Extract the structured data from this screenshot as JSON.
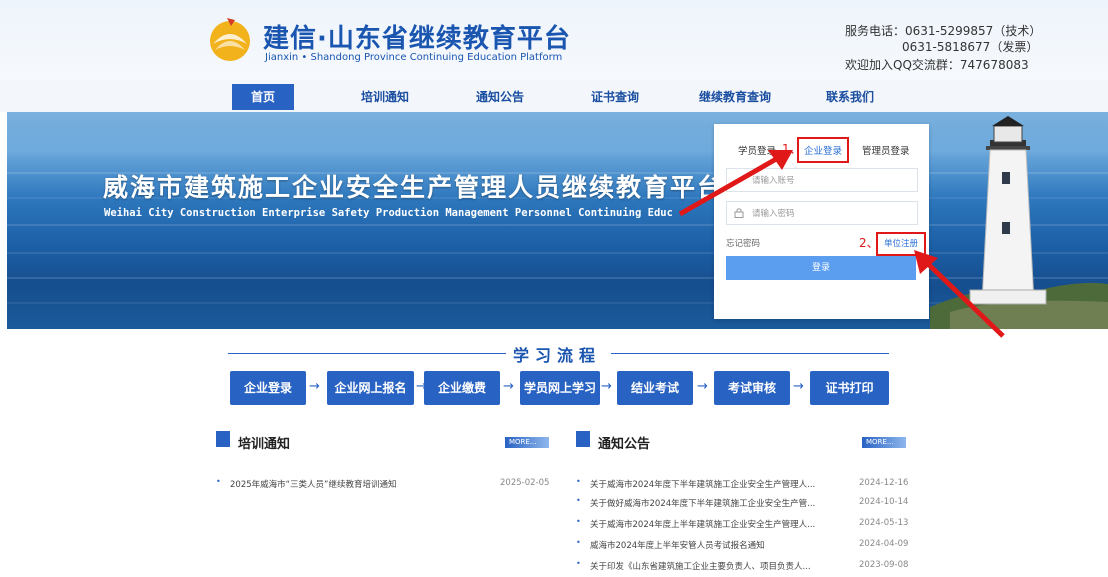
{
  "header": {
    "title": "建信·山东省继续教育平台",
    "subtitle": "Jianxin • Shandong Province Continuing Education Platform",
    "service_phone_1": "服务电话：0631-5299857（技术）",
    "service_phone_2": "0631-5818677（发票）",
    "qq_group": "欢迎加入QQ交流群：747678083"
  },
  "nav": {
    "items": [
      {
        "label": "首页"
      },
      {
        "label": "培训通知"
      },
      {
        "label": "通知公告"
      },
      {
        "label": "证书查询"
      },
      {
        "label": "继续教育查询"
      },
      {
        "label": "联系我们"
      }
    ]
  },
  "banner": {
    "title": "威海市建筑施工企业安全生产管理人员继续教育平台",
    "subtitle": "Weihai City Construction Enterprise Safety Production Management Personnel Continuing Education Platform"
  },
  "login": {
    "tabs": [
      {
        "label": "学员登录"
      },
      {
        "label": "企业登录"
      },
      {
        "label": "管理员登录"
      }
    ],
    "account_placeholder": "请输入账号",
    "password_placeholder": "请输入密码",
    "forgot_label": "忘记密码",
    "register_label": "单位注册",
    "submit_label": "登录"
  },
  "annotations": {
    "step1": "1、",
    "step2": "2、",
    "color": "#e01818"
  },
  "process": {
    "title": "学习流程",
    "steps": [
      {
        "label": "企业登录"
      },
      {
        "label": "企业网上报名"
      },
      {
        "label": "企业缴费"
      },
      {
        "label": "学员网上学习"
      },
      {
        "label": "结业考试"
      },
      {
        "label": "考试审核"
      },
      {
        "label": "证书打印"
      }
    ]
  },
  "training_notices": {
    "title": "培训通知",
    "more_label": "MORE...",
    "items": [
      {
        "title": "2025年威海市“三类人员”继续教育培训通知",
        "date": "2025-02-05"
      }
    ]
  },
  "announcements": {
    "title": "通知公告",
    "more_label": "MORE...",
    "items": [
      {
        "title": "关于威海市2024年度下半年建筑施工企业安全生产管理人...",
        "date": "2024-12-16"
      },
      {
        "title": "关于做好威海市2024年度下半年建筑施工企业安全生产管...",
        "date": "2024-10-14"
      },
      {
        "title": "关于威海市2024年度上半年建筑施工企业安全生产管理人...",
        "date": "2024-05-13"
      },
      {
        "title": "威海市2024年度上半年安管人员考试报名通知",
        "date": "2024-04-09"
      },
      {
        "title": "关于印发《山东省建筑施工企业主要负责人、项目负责人...",
        "date": "2023-09-08"
      }
    ]
  },
  "colors": {
    "brand": "#1a55b0",
    "nav_active": "#2862c3",
    "login_button": "#5b9ef0"
  }
}
